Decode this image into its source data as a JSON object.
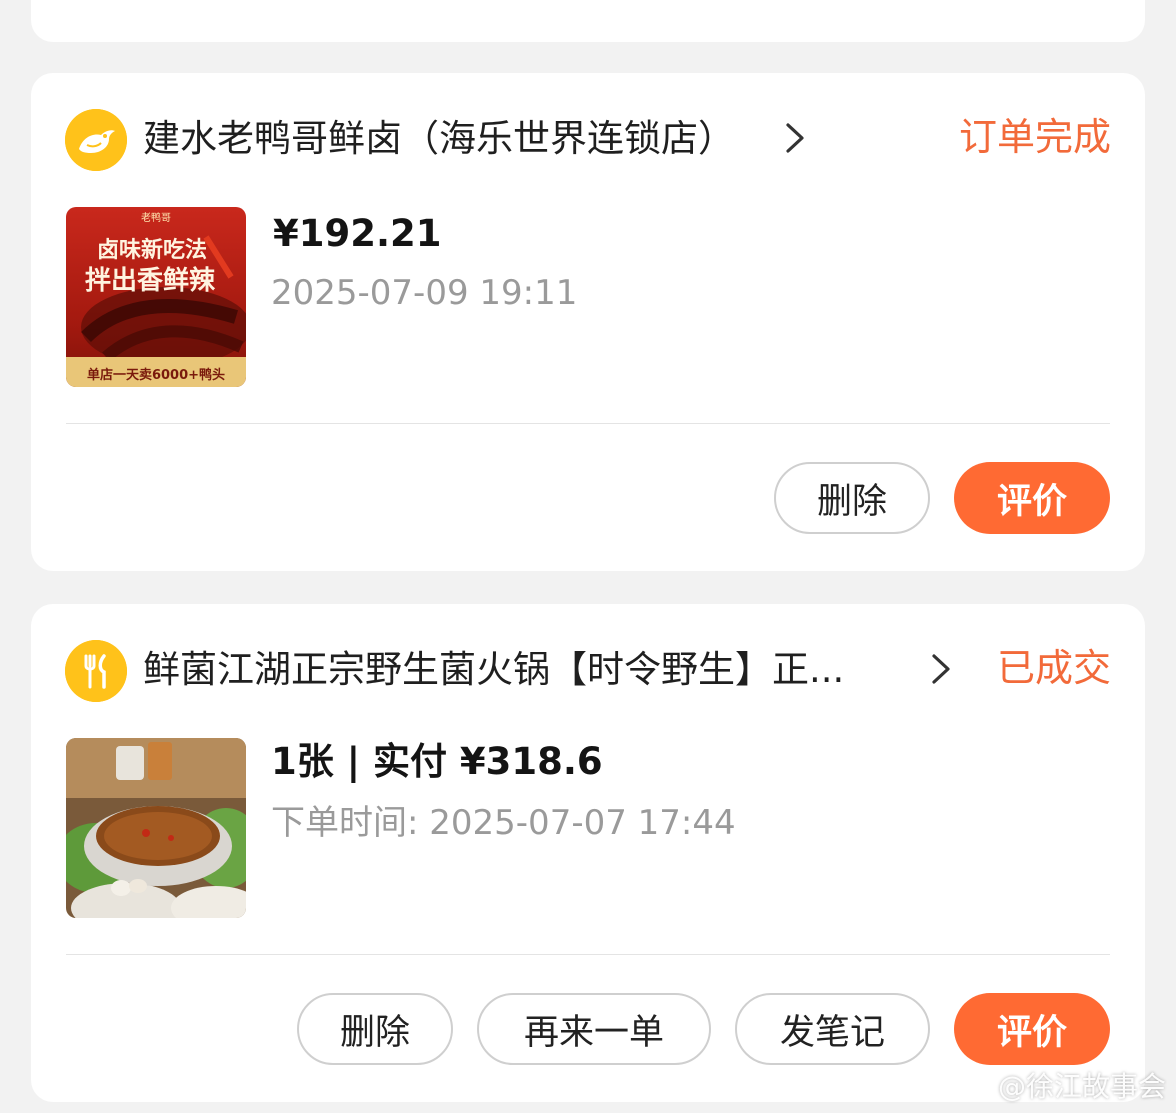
{
  "orders": [
    {
      "shop_name": "建水老鸭哥鲜卤（海乐世界连锁店）",
      "status": "订单完成",
      "price": "¥192.21",
      "time": "2025-07-09 19:11",
      "thumb_text": {
        "brand": "老鸭哥",
        "line1": "卤味新吃法",
        "line2": "拌出香鲜辣",
        "footer": "单店一天卖6000+鸭头"
      },
      "buttons": [
        {
          "label": "删除"
        },
        {
          "label": "评价"
        }
      ]
    },
    {
      "shop_name": "鲜菌江湖正宗野生菌火锅【时令野生】正...",
      "status": "已成交",
      "price": "1张 | 实付 ¥318.6",
      "time": "下单时间: 2025-07-07 17:44",
      "buttons": [
        {
          "label": "删除"
        },
        {
          "label": "再来一单"
        },
        {
          "label": "发笔记"
        },
        {
          "label": "评价"
        }
      ]
    }
  ],
  "watermark": "@徐江故事会",
  "colors": {
    "accent": "#ff6a33",
    "status": "#f26a3a",
    "logo_bg": "#ffc21a"
  },
  "icons": {
    "chevron": "chevron-right-icon",
    "shop1": "duck-logo-icon",
    "shop2": "fork-knife-icon"
  }
}
